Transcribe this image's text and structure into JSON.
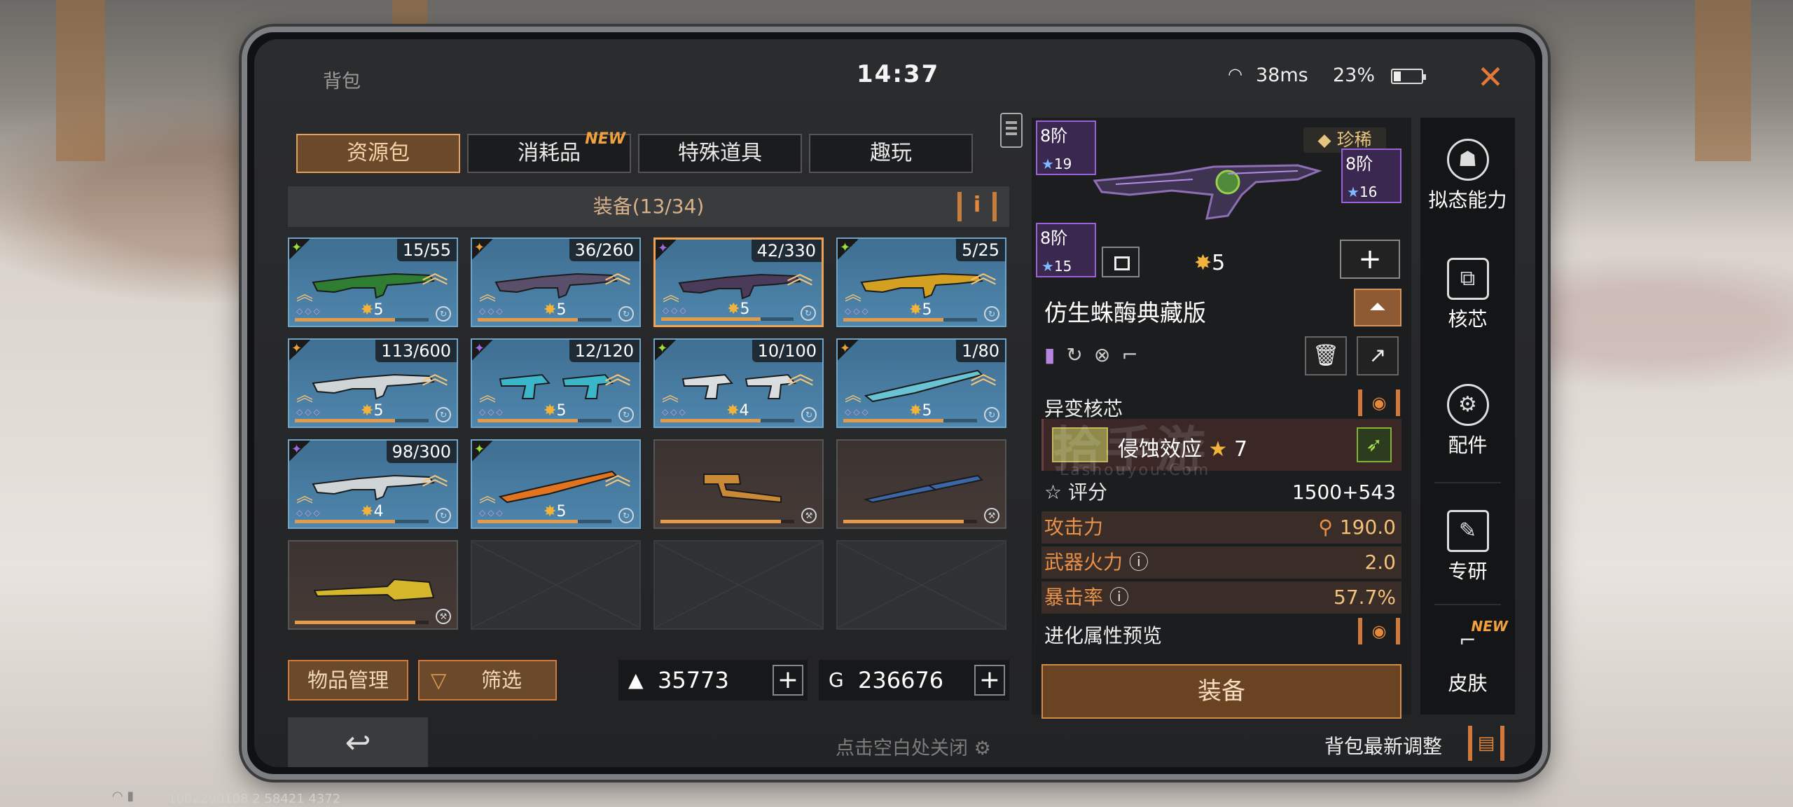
{
  "status": {
    "title": "背包",
    "clock": "14:37",
    "ping": "38ms",
    "battery": "23%"
  },
  "tabs": [
    {
      "label": "资源包",
      "active": true,
      "badge": ""
    },
    {
      "label": "消耗品",
      "active": false,
      "badge": "NEW"
    },
    {
      "label": "特殊道具",
      "active": false,
      "badge": ""
    },
    {
      "label": "趣玩",
      "active": false,
      "badge": ""
    }
  ],
  "section": {
    "title": "装备(13/34)",
    "info": "i"
  },
  "items": [
    {
      "count": "15/55",
      "stars": "5",
      "type": "gun",
      "color": "#2e7d32"
    },
    {
      "count": "36/260",
      "stars": "5",
      "type": "gun",
      "color": "#5a4f6a"
    },
    {
      "count": "42/330",
      "stars": "5",
      "type": "gun",
      "color": "#4b3b5b"
    },
    {
      "count": "5/25",
      "stars": "5",
      "type": "gun",
      "color": "#d4a021"
    },
    {
      "count": "113/600",
      "stars": "5",
      "type": "gun",
      "color": "#cfd4d6"
    },
    {
      "count": "12/120",
      "stars": "5",
      "type": "pistol",
      "color": "#3bb5c9"
    },
    {
      "count": "10/100",
      "stars": "4",
      "type": "pistol",
      "color": "#d9dde0"
    },
    {
      "count": "1/80",
      "stars": "5",
      "type": "blade",
      "color": "#6ac2d5"
    },
    {
      "count": "98/300",
      "stars": "4",
      "type": "gun",
      "color": "#cfd4d6"
    },
    {
      "count": "",
      "stars": "5",
      "type": "blade",
      "color": "#e2741f"
    },
    {
      "count": "",
      "stars": "",
      "type": "hammer",
      "color": "#c98936"
    },
    {
      "count": "",
      "stars": "",
      "type": "screwdriver",
      "color": "#3b66a8"
    },
    {
      "count": "",
      "stars": "",
      "type": "chainsaw",
      "color": "#d6b72b"
    }
  ],
  "bottom": {
    "manage_label": "物品管理",
    "filter_label": "筛选",
    "currency1": "35773",
    "currency2": "236676"
  },
  "detail": {
    "rarity": "珍稀",
    "attachments": [
      {
        "tier": "8阶",
        "value": "19"
      },
      {
        "tier": "8阶",
        "value": "16"
      },
      {
        "tier": "8阶",
        "value": "15"
      }
    ],
    "weapon_stars": "5",
    "weapon_name": "仿生蛛酶典藏版",
    "core_label": "异变核芯",
    "core_name": "侵蚀效应",
    "core_stars": "7",
    "score_label": "评分",
    "score_value": "1500+543",
    "stats": [
      {
        "label": "攻击力",
        "value": "190.0"
      },
      {
        "label": "武器火力",
        "value": "2.0"
      },
      {
        "label": "暴击率",
        "value": "57.7%"
      }
    ],
    "preview_label": "进化属性预览",
    "equip_label": "装备"
  },
  "sidemenu": [
    {
      "label": "拟态能力",
      "icon": "mimic-icon",
      "badge": ""
    },
    {
      "label": "核芯",
      "icon": "core-icon",
      "badge": ""
    },
    {
      "label": "配件",
      "icon": "gear-icon",
      "badge": ""
    },
    {
      "label": "专研",
      "icon": "research-icon",
      "badge": ""
    },
    {
      "label": "皮肤",
      "icon": "skin-gun-icon",
      "badge": "NEW"
    }
  ],
  "footer": {
    "close_hint": "点击空白处关闭",
    "update_label": "背包最新调整"
  },
  "watermark": {
    "main": "拾手游",
    "sub": "Lashouyou.Com"
  },
  "build_id": "1002290108 2 58421 4372"
}
